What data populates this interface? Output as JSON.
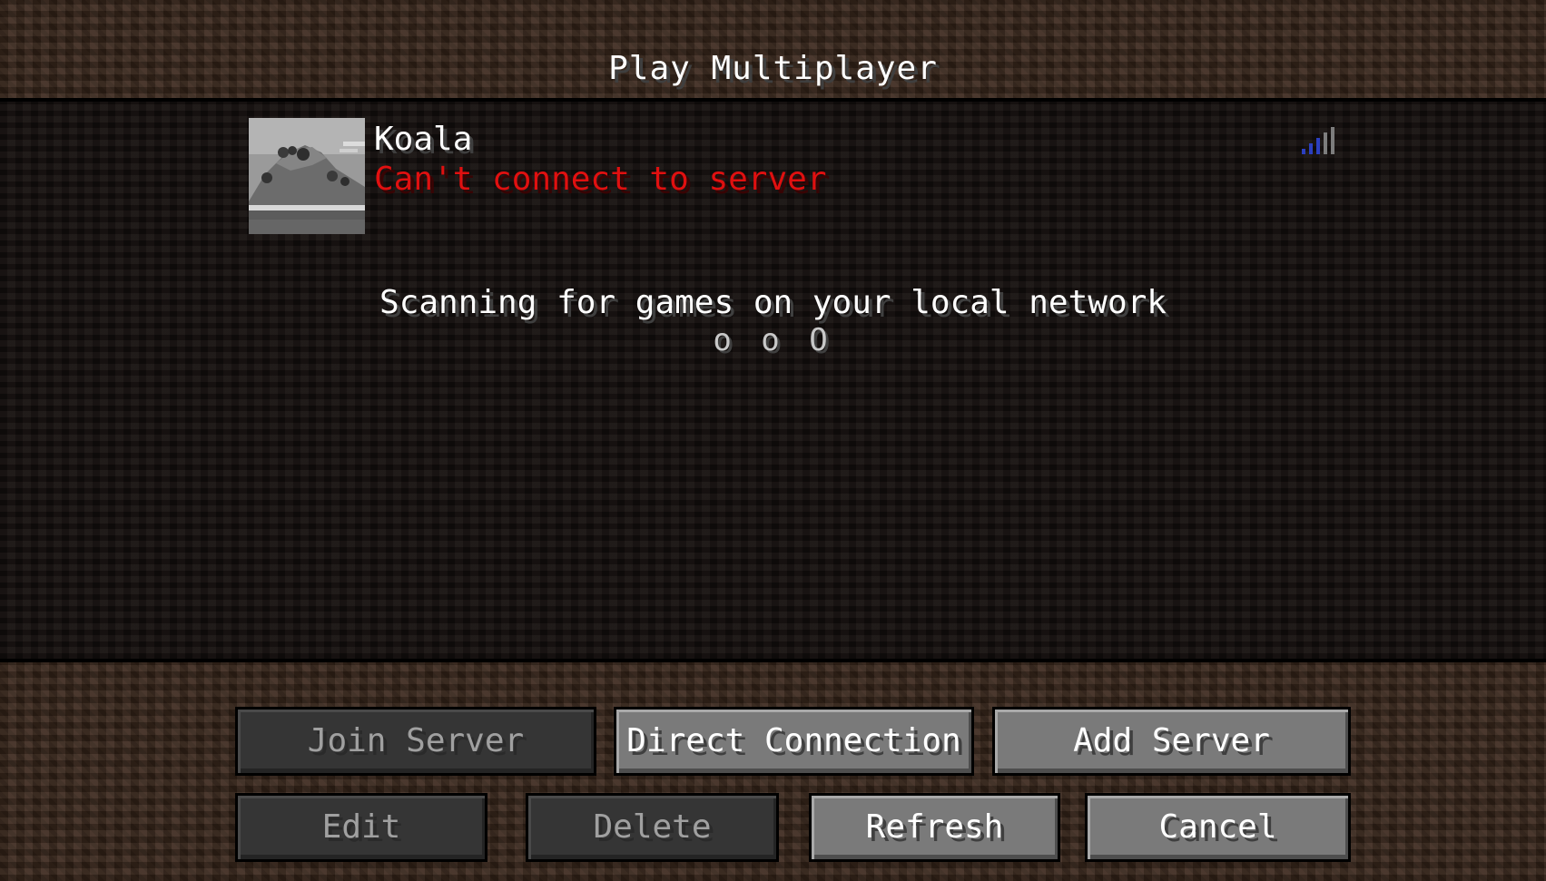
{
  "screen": {
    "title": "Play Multiplayer"
  },
  "servers": [
    {
      "name": "Koala",
      "status": "Can't connect to server",
      "status_color": "#e01010",
      "icon": "signal-bars-icon"
    }
  ],
  "lan_scan": {
    "text": "Scanning for games on your local network",
    "indicator": "o o O"
  },
  "buttons": {
    "join_server": "Join Server",
    "direct_connection": "Direct Connection",
    "add_server": "Add Server",
    "edit": "Edit",
    "delete": "Delete",
    "refresh": "Refresh",
    "cancel": "Cancel"
  },
  "colors": {
    "button_enabled": "#7a7a7a",
    "button_disabled": "#353535",
    "text": "#ffffff",
    "text_disabled": "#a0a0a0"
  }
}
